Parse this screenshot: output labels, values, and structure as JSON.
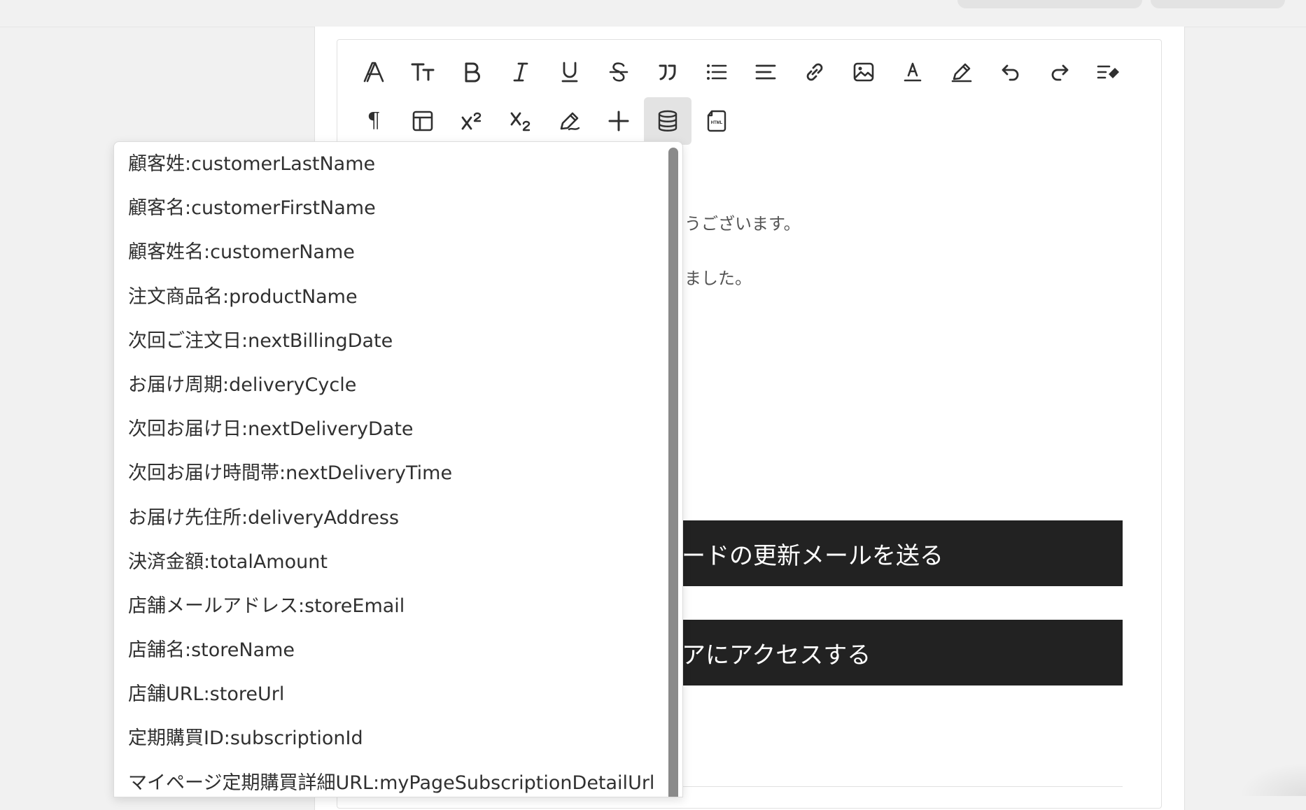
{
  "toolbar": {
    "row1": [
      {
        "icon": "font-family-icon",
        "glyph": "𝔸"
      },
      {
        "icon": "font-size-icon",
        "glyph": "Tт"
      },
      {
        "icon": "bold-icon",
        "glyph": "B"
      },
      {
        "icon": "italic-icon",
        "glyph": "I"
      },
      {
        "icon": "underline-icon",
        "glyph": "U"
      },
      {
        "icon": "strikethrough-icon",
        "glyph": "S"
      },
      {
        "icon": "blockquote-icon",
        "glyph": "❞"
      },
      {
        "icon": "bullet-list-icon",
        "glyph": ""
      },
      {
        "icon": "align-icon",
        "glyph": ""
      },
      {
        "icon": "link-icon",
        "glyph": ""
      },
      {
        "icon": "image-icon",
        "glyph": ""
      },
      {
        "icon": "text-color-icon",
        "glyph": "A"
      },
      {
        "icon": "highlight-icon",
        "glyph": ""
      },
      {
        "icon": "undo-icon",
        "glyph": "↶"
      },
      {
        "icon": "redo-icon",
        "glyph": "↷"
      },
      {
        "icon": "clear-format-icon",
        "glyph": ""
      }
    ],
    "row2": [
      {
        "icon": "paragraph-icon",
        "glyph": "¶"
      },
      {
        "icon": "table-icon",
        "glyph": ""
      },
      {
        "icon": "superscript-icon",
        "glyph": "X²"
      },
      {
        "icon": "subscript-icon",
        "glyph": "X₂"
      },
      {
        "icon": "edit-icon",
        "glyph": ""
      },
      {
        "icon": "plus-icon",
        "glyph": "+"
      },
      {
        "icon": "database-icon",
        "glyph": "",
        "active": true
      },
      {
        "icon": "html-file-icon",
        "glyph": "HTML"
      }
    ]
  },
  "editor": {
    "line1": "うございます。",
    "line2": "ました。",
    "cta1": "ードの更新メールを送る",
    "cta2": "アにアクセスする"
  },
  "variables_dropdown": {
    "items": [
      "顧客姓:customerLastName",
      "顧客名:customerFirstName",
      "顧客姓名:customerName",
      "注文商品名:productName",
      "次回ご注文日:nextBillingDate",
      "お届け周期:deliveryCycle",
      "次回お届け日:nextDeliveryDate",
      "次回お届け時間帯:nextDeliveryTime",
      "お届け先住所:deliveryAddress",
      "決済金額:totalAmount",
      "店舗メールアドレス:storeEmail",
      "店舗名:storeName",
      "店舗URL:storeUrl",
      "定期購買ID:subscriptionId",
      "マイページ定期購買詳細URL:myPageSubscriptionDetailUrl"
    ]
  },
  "colors": {
    "background": "#f1f1f1",
    "panel": "#ffffff",
    "active_button": "#e3e3e3",
    "cta_background": "#222222",
    "scrollbar": "#8a8a8a"
  }
}
